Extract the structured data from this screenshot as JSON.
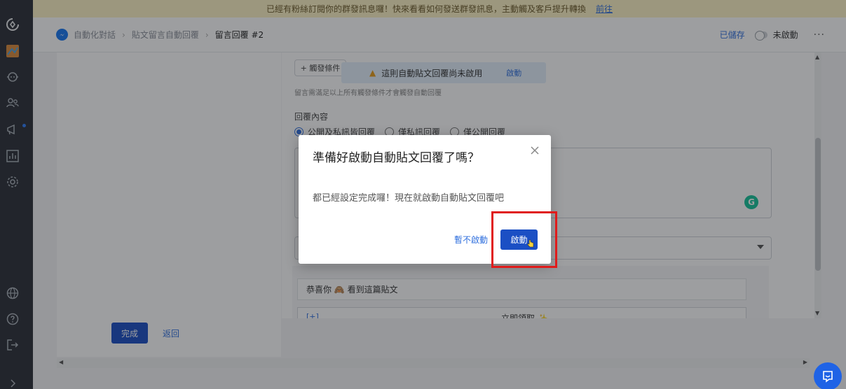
{
  "banner": {
    "text": "已經有粉絲訂閱你的群發訊息囉！快來看看如何發送群發訊息，主動觸及客戶提升轉換",
    "link": "前往"
  },
  "header": {
    "breadcrumbs": [
      "自動化對話",
      "貼文留言自動回覆",
      "留言回覆 #2"
    ],
    "saved": "已儲存",
    "status": "未啟動",
    "more": "···"
  },
  "form": {
    "trigger_button": "+ 觸發條件",
    "warning": "這則自動貼文回覆尚未啟用",
    "warning_action": "啟動",
    "hint": "留言需滿足以上所有觸發條件才會觸發自動回覆",
    "reply_label": "回覆內容",
    "reply_options": [
      "公開及私訊皆回覆",
      "僅私訊回覆",
      "僅公開回覆"
    ],
    "preview_text": "恭喜你 🙈 看到這篇貼文",
    "preview_button_code": "[+]",
    "preview_button_label": "立即領取 ✨"
  },
  "actions": {
    "done": "完成",
    "back": "返回"
  },
  "modal": {
    "title": "準備好啟動自動貼文回覆了嗎？",
    "body": "都已經設定完成囉！現在就啟動自動貼文回覆吧",
    "cancel": "暫不啟動",
    "confirm": "啟動"
  },
  "colors": {
    "primary": "#1b4fc4",
    "link": "#2f6fde",
    "sidebar": "#2b3038",
    "banner": "#fef3c4",
    "highlight": "#e01b1b"
  }
}
